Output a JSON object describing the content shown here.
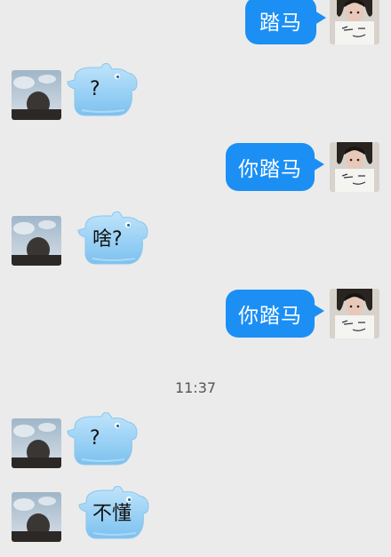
{
  "messages": [
    {
      "side": "out",
      "text": "踏马"
    },
    {
      "side": "in",
      "text": "?"
    },
    {
      "side": "out",
      "text": "你踏马"
    },
    {
      "side": "in",
      "text": "啥?"
    },
    {
      "side": "out",
      "text": "你踏马"
    },
    {
      "side": "in",
      "text": "?"
    },
    {
      "side": "in",
      "text": "不懂"
    }
  ],
  "timestamp": "11:37",
  "colors": {
    "background": "#ebebeb",
    "outgoing_bubble": "#1b8ff4",
    "incoming_bubble": "#9fd3f7",
    "timestamp_text": "#555555"
  },
  "icons": {
    "left_avatar": "user-avatar-sky-photo",
    "right_avatar": "user-avatar-girl-holding-paper",
    "incoming_bubble_shape": "hippo-bubble"
  }
}
